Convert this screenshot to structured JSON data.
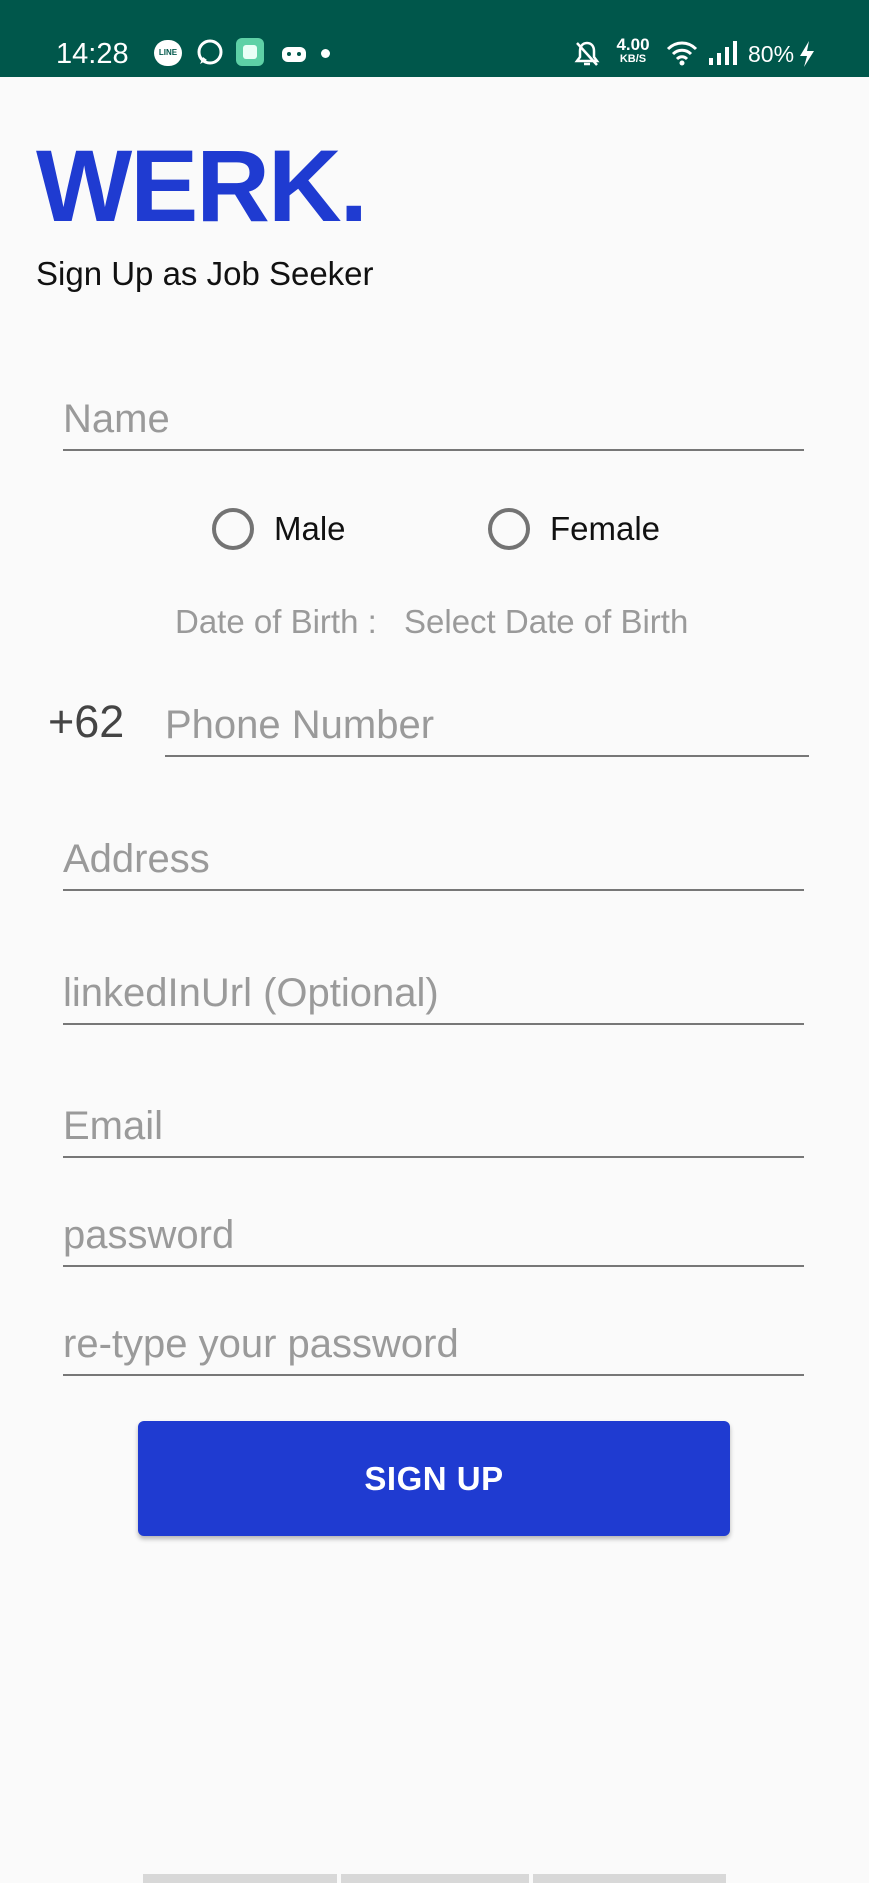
{
  "status_bar": {
    "time": "14:28",
    "line_label": "LINE",
    "net_speed_value": "4.00",
    "net_speed_unit": "KB/S",
    "battery": "80%",
    "background_color": "#00574b",
    "icons": [
      "line-icon",
      "whatsapp-icon",
      "app-icon",
      "game-icon",
      "notification-dot",
      "mute-icon",
      "wifi-icon",
      "signal-icon",
      "charging-icon"
    ]
  },
  "header": {
    "logo": "WERK.",
    "subtitle": "Sign Up as Job Seeker",
    "brand_color": "#1f3bd1"
  },
  "form": {
    "name_placeholder": "Name",
    "gender_options": [
      "Male",
      "Female"
    ],
    "dob_label": "Date of Birth :",
    "dob_select": "Select Date of Birth",
    "phone_prefix": "+62",
    "phone_placeholder": "Phone Number",
    "address_placeholder": "Address",
    "linkedin_placeholder": "linkedInUrl (Optional)",
    "email_placeholder": "Email",
    "password_placeholder": "password",
    "retype_placeholder": "re-type your password",
    "submit_label": "SIGN UP"
  }
}
